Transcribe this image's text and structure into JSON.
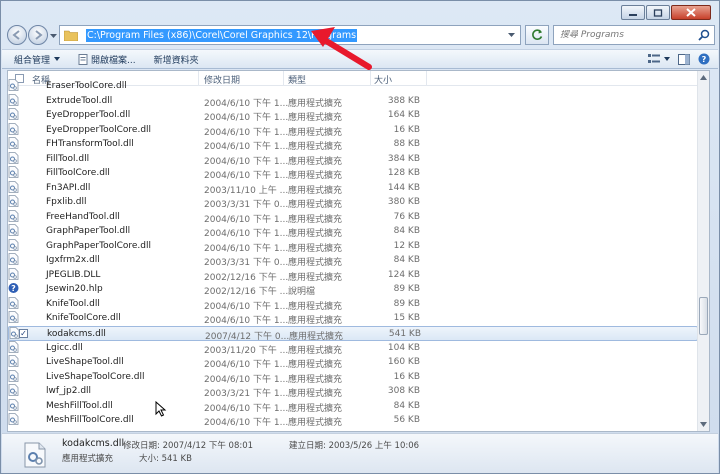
{
  "address": {
    "path": "C:\\Program Files (x86)\\Corel\\Corel Graphics 12\\Programs"
  },
  "search": {
    "placeholder": "搜尋 Programs"
  },
  "toolbar": {
    "organize": "組合管理",
    "open_file": "開啟檔案...",
    "new_folder": "新增資料夾"
  },
  "columns": {
    "name": "名稱",
    "date": "修改日期",
    "type": "類型",
    "size": "大小"
  },
  "files": [
    {
      "name": "EraserToolCore.dll",
      "date": "",
      "type": "",
      "size": ""
    },
    {
      "name": "ExtrudeTool.dll",
      "date": "2004/6/10 下午 1...",
      "type": "應用程式擴充",
      "size": "388 KB"
    },
    {
      "name": "EyeDropperTool.dll",
      "date": "2004/6/10 下午 1...",
      "type": "應用程式擴充",
      "size": "164 KB"
    },
    {
      "name": "EyeDropperToolCore.dll",
      "date": "2004/6/10 下午 1...",
      "type": "應用程式擴充",
      "size": "16 KB"
    },
    {
      "name": "FHTransformTool.dll",
      "date": "2004/6/10 下午 1...",
      "type": "應用程式擴充",
      "size": "88 KB"
    },
    {
      "name": "FillTool.dll",
      "date": "2004/6/10 下午 1...",
      "type": "應用程式擴充",
      "size": "384 KB"
    },
    {
      "name": "FillToolCore.dll",
      "date": "2004/6/10 下午 1...",
      "type": "應用程式擴充",
      "size": "128 KB"
    },
    {
      "name": "Fn3API.dll",
      "date": "2003/11/10 上午 ...",
      "type": "應用程式擴充",
      "size": "144 KB"
    },
    {
      "name": "Fpxlib.dll",
      "date": "2003/3/31 下午 0...",
      "type": "應用程式擴充",
      "size": "380 KB"
    },
    {
      "name": "FreeHandTool.dll",
      "date": "2004/6/10 下午 1...",
      "type": "應用程式擴充",
      "size": "76 KB"
    },
    {
      "name": "GraphPaperTool.dll",
      "date": "2004/6/10 下午 1...",
      "type": "應用程式擴充",
      "size": "84 KB"
    },
    {
      "name": "GraphPaperToolCore.dll",
      "date": "2004/6/10 下午 1...",
      "type": "應用程式擴充",
      "size": "12 KB"
    },
    {
      "name": "Igxfrm2x.dll",
      "date": "2003/3/31 下午 0...",
      "type": "應用程式擴充",
      "size": "84 KB"
    },
    {
      "name": "JPEGLIB.DLL",
      "date": "2002/12/16 下午 ...",
      "type": "應用程式擴充",
      "size": "124 KB"
    },
    {
      "name": "Jsewin20.hlp",
      "date": "2002/12/16 下午 ...",
      "type": "說明檔",
      "size": "89 KB"
    },
    {
      "name": "KnifeTool.dll",
      "date": "2004/6/10 下午 1...",
      "type": "應用程式擴充",
      "size": "89 KB"
    },
    {
      "name": "KnifeToolCore.dll",
      "date": "2004/6/10 下午 1...",
      "type": "應用程式擴充",
      "size": "15 KB"
    },
    {
      "name": "kodakcms.dll",
      "date": "2007/4/12 下午 0...",
      "type": "應用程式擴充",
      "size": "541 KB"
    },
    {
      "name": "Lgicc.dll",
      "date": "2003/11/20 下午 ...",
      "type": "應用程式擴充",
      "size": "104 KB"
    },
    {
      "name": "LiveShapeTool.dll",
      "date": "2004/6/10 下午 1...",
      "type": "應用程式擴充",
      "size": "160 KB"
    },
    {
      "name": "LiveShapeToolCore.dll",
      "date": "2004/6/10 下午 1...",
      "type": "應用程式擴充",
      "size": "16 KB"
    },
    {
      "name": "lwf_jp2.dll",
      "date": "2003/3/21 下午 1...",
      "type": "應用程式擴充",
      "size": "308 KB"
    },
    {
      "name": "MeshFillTool.dll",
      "date": "2004/6/10 下午 1...",
      "type": "應用程式擴充",
      "size": "84 KB"
    },
    {
      "name": "MeshFillToolCore.dll",
      "date": "2004/6/10 下午 1...",
      "type": "應用程式擴充",
      "size": "56 KB"
    }
  ],
  "selected_check": "✓",
  "details": {
    "name": "kodakcms.dll",
    "modified": "修改日期: 2007/4/12 下午 08:01",
    "created": "建立日期: 2003/5/26 上午 10:06",
    "type": "應用程式擴充",
    "size": "大小: 541 KB"
  },
  "colors": {
    "selection": "#3399ff",
    "arrow": "#e8192c"
  }
}
